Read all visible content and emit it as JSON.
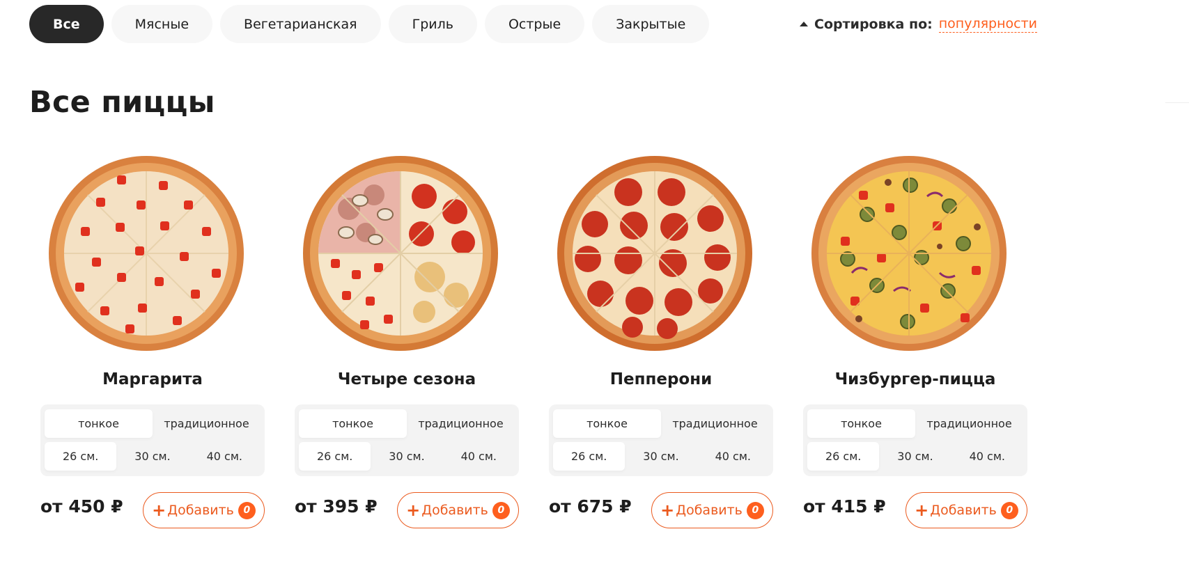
{
  "categories": {
    "items": [
      {
        "label": "Все",
        "active": true
      },
      {
        "label": "Мясные",
        "active": false
      },
      {
        "label": "Вегетарианская",
        "active": false
      },
      {
        "label": "Гриль",
        "active": false
      },
      {
        "label": "Острые",
        "active": false
      },
      {
        "label": "Закрытые",
        "active": false
      }
    ]
  },
  "sort": {
    "label": "Сортировка по:",
    "value": "популярности"
  },
  "page_title": "Все пиццы",
  "colors": {
    "accent": "#fe5f1e",
    "active_category": "#282828",
    "chip_bg": "#f7f7f7",
    "selector_bg": "#f3f3f3"
  },
  "pizzas": [
    {
      "name": "Маргарита",
      "image_icon": "pizza-margherita-image",
      "types": [
        "тонкое",
        "традиционное"
      ],
      "sizes": [
        "26 см.",
        "30 см.",
        "40 см."
      ],
      "active_type": 0,
      "active_size": 0,
      "price": "от 450 ₽",
      "add_plus": "+",
      "add_label": "Добавить",
      "count": "0"
    },
    {
      "name": "Четыре сезона",
      "image_icon": "pizza-four-seasons-image",
      "types": [
        "тонкое",
        "традиционное"
      ],
      "sizes": [
        "26 см.",
        "30 см.",
        "40 см."
      ],
      "active_type": 0,
      "active_size": 0,
      "price": "от 395 ₽",
      "add_plus": "+",
      "add_label": "Добавить",
      "count": "0"
    },
    {
      "name": "Пепперони",
      "image_icon": "pizza-pepperoni-image",
      "types": [
        "тонкое",
        "традиционное"
      ],
      "sizes": [
        "26 см.",
        "30 см.",
        "40 см."
      ],
      "active_type": 0,
      "active_size": 0,
      "price": "от 675 ₽",
      "add_plus": "+",
      "add_label": "Добавить",
      "count": "0"
    },
    {
      "name": "Чизбургер-пицца",
      "image_icon": "pizza-cheeseburger-image",
      "types": [
        "тонкое",
        "традиционное"
      ],
      "sizes": [
        "26 см.",
        "30 см.",
        "40 см."
      ],
      "active_type": 0,
      "active_size": 0,
      "price": "от 415 ₽",
      "add_plus": "+",
      "add_label": "Добавить",
      "count": "0"
    }
  ]
}
